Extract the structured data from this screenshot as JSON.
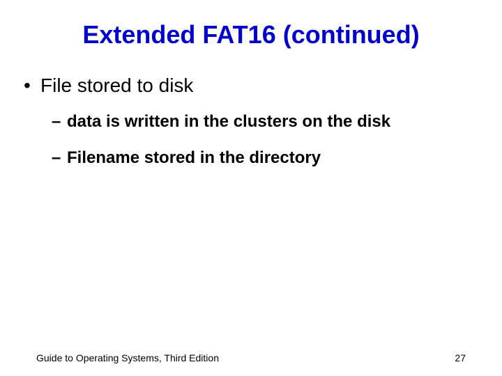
{
  "title": "Extended FAT16 (continued)",
  "bullets": {
    "l1_0": "File stored to disk",
    "l2_0": "data is written in the clusters on the disk",
    "l2_1": "Filename stored in the directory"
  },
  "footer": {
    "left": "Guide to Operating Systems, Third Edition",
    "right": "27"
  }
}
